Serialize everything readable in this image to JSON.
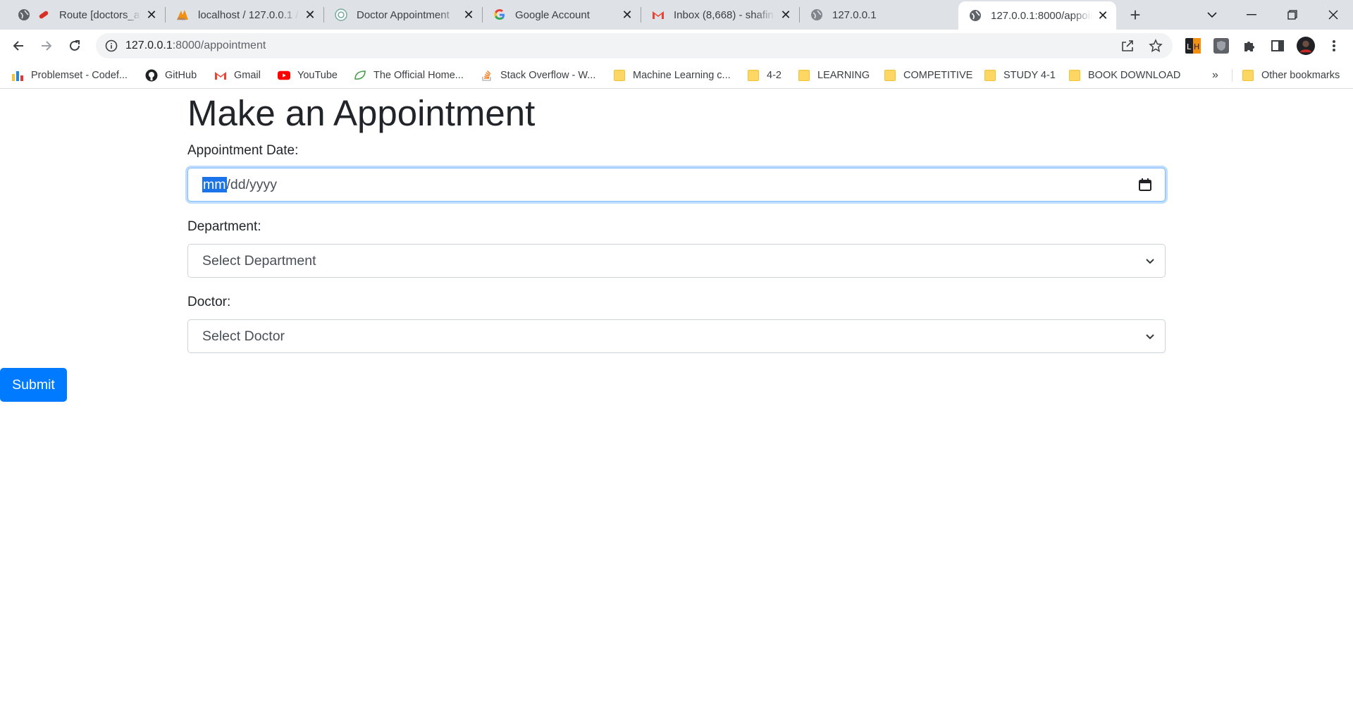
{
  "browser": {
    "tabs": [
      {
        "title": "Route [doctors_ap",
        "favicon": "red-pill-icon"
      },
      {
        "title": "localhost / 127.0.0.1 /",
        "favicon": "phpmyadmin-icon"
      },
      {
        "title": "Doctor Appointment",
        "favicon": "chatgpt-icon"
      },
      {
        "title": "Google Account",
        "favicon": "google-icon"
      },
      {
        "title": "Inbox (8,668) - shafin",
        "favicon": "gmail-icon"
      },
      {
        "title": "127.0.0.1",
        "favicon": "globe-icon"
      },
      {
        "title": "127.0.0.1:8000/appoin",
        "favicon": "globe-icon",
        "active": true
      }
    ],
    "address": {
      "host": "127.0.0.1",
      "rest": ":8000/appointment"
    },
    "bookmarks": [
      {
        "label": "Problemset - Codef...",
        "icon": "codeforces-icon"
      },
      {
        "label": "GitHub",
        "icon": "github-icon"
      },
      {
        "label": "Gmail",
        "icon": "gmail-icon"
      },
      {
        "label": "YouTube",
        "icon": "youtube-icon"
      },
      {
        "label": "The Official Home...",
        "icon": "leaf-icon"
      },
      {
        "label": "Stack Overflow - W...",
        "icon": "stackoverflow-icon"
      },
      {
        "label": "Machine Learning c...",
        "icon": "folder-icon"
      },
      {
        "label": "4-2",
        "icon": "folder-icon"
      },
      {
        "label": "LEARNING",
        "icon": "folder-icon"
      },
      {
        "label": "COMPETITIVE",
        "icon": "folder-icon"
      },
      {
        "label": "STUDY 4-1",
        "icon": "folder-icon"
      },
      {
        "label": "BOOK DOWNLOAD",
        "icon": "folder-icon"
      }
    ],
    "bookmarks_more": "»",
    "other_bookmarks": "Other bookmarks"
  },
  "page": {
    "title": "Make an Appointment",
    "date_label": "Appointment Date:",
    "date_placeholder": {
      "mm": "mm",
      "rest": "/dd/yyyy"
    },
    "department_label": "Department:",
    "department_selected": "Select Department",
    "doctor_label": "Doctor:",
    "doctor_selected": "Select Doctor",
    "submit_label": "Submit"
  },
  "colors": {
    "primary": "#007bff",
    "text": "#212529",
    "tabstrip": "#dee1e6",
    "date_selection": "#1a73e8"
  }
}
